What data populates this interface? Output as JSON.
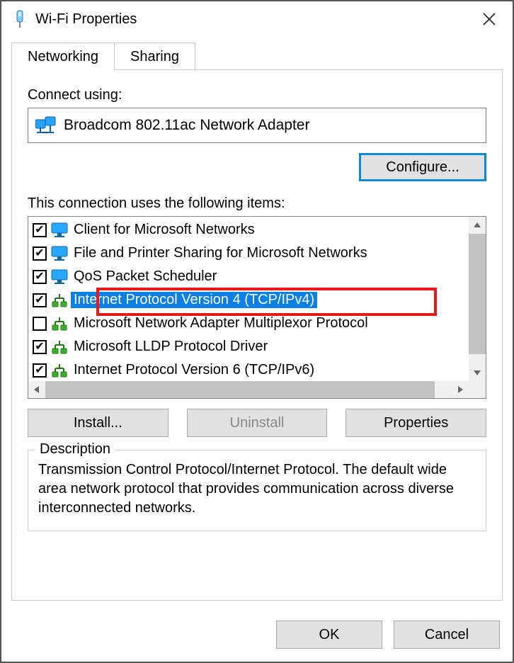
{
  "window": {
    "title": "Wi-Fi Properties"
  },
  "tabs": {
    "networking": "Networking",
    "sharing": "Sharing"
  },
  "connect_using_label": "Connect using:",
  "adapter_name": "Broadcom 802.11ac Network Adapter",
  "configure_label": "Configure...",
  "items_label": "This connection uses the following items:",
  "items": [
    {
      "checked": true,
      "icon": "monitor-icon",
      "label": "Client for Microsoft Networks"
    },
    {
      "checked": true,
      "icon": "monitor-icon",
      "label": "File and Printer Sharing for Microsoft Networks"
    },
    {
      "checked": true,
      "icon": "monitor-icon",
      "label": "QoS Packet Scheduler"
    },
    {
      "checked": true,
      "icon": "protocol-icon",
      "label": "Internet Protocol Version 4 (TCP/IPv4)",
      "selected": true
    },
    {
      "checked": false,
      "icon": "protocol-icon",
      "label": "Microsoft Network Adapter Multiplexor Protocol"
    },
    {
      "checked": true,
      "icon": "protocol-icon",
      "label": "Microsoft LLDP Protocol Driver"
    },
    {
      "checked": true,
      "icon": "protocol-icon",
      "label": "Internet Protocol Version 6 (TCP/IPv6)"
    }
  ],
  "install_label": "Install...",
  "uninstall_label": "Uninstall",
  "properties_label": "Properties",
  "description_legend": "Description",
  "description_text": "Transmission Control Protocol/Internet Protocol. The default wide area network protocol that provides communication across diverse interconnected networks.",
  "ok_label": "OK",
  "cancel_label": "Cancel"
}
